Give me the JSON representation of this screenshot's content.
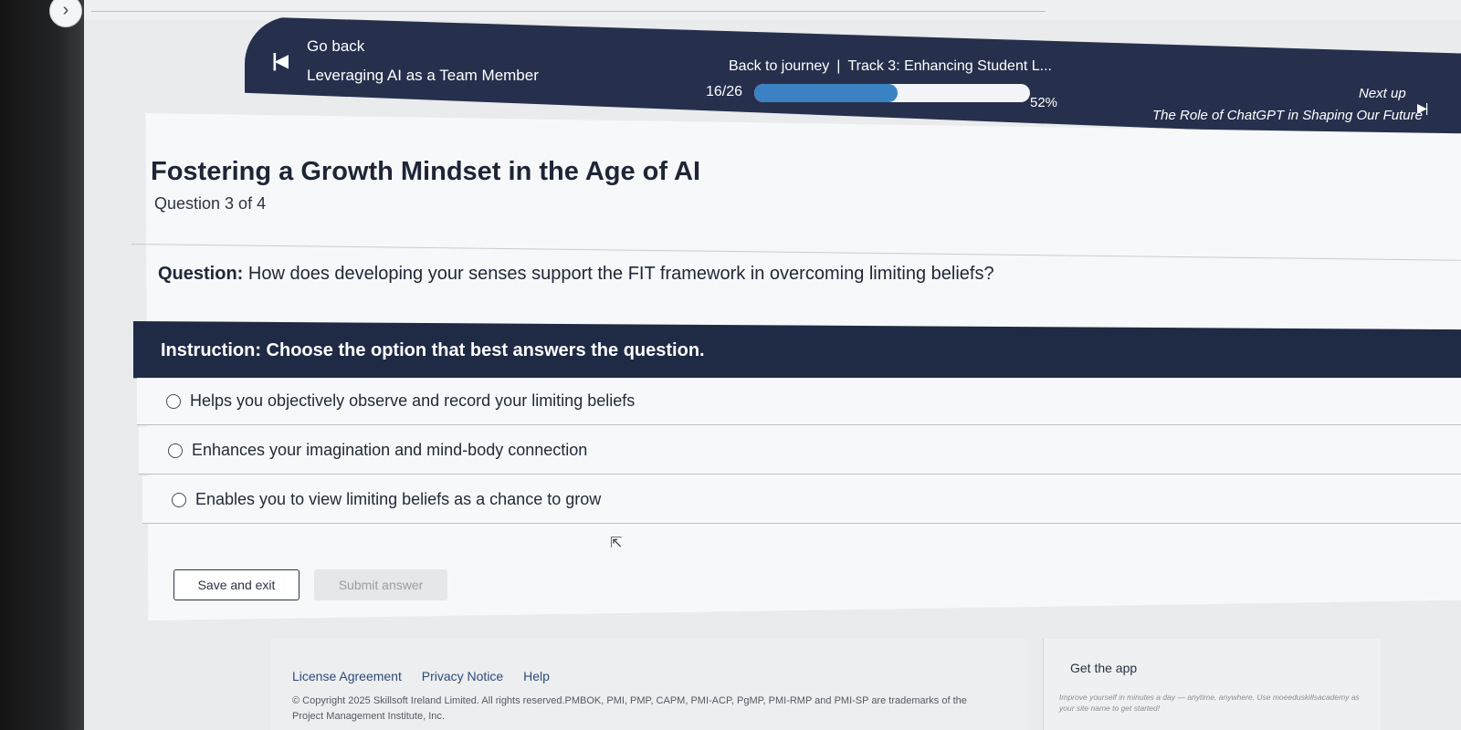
{
  "header": {
    "go_back_label": "Go back",
    "course_title": "Leveraging AI as a Team Member",
    "journey_link": "Back to journey",
    "track": "Track 3: Enhancing Student L...",
    "progress_text": "16/26",
    "progress_value": 0.52,
    "progress_percent": "52%",
    "next_up_label": "Next up",
    "next_up_title": "The Role of ChatGPT in Shaping Our Future"
  },
  "quiz": {
    "title": "Fostering a Growth Mindset in the Age of AI",
    "question_count": "Question 3 of 4",
    "question_prefix": "Question:",
    "question_text": "How does developing your senses support the FIT framework in overcoming limiting beliefs?",
    "instruction": "Instruction: Choose the option that best answers the question.",
    "options": [
      {
        "label": "Helps you objectively observe and record your limiting beliefs",
        "selected": false
      },
      {
        "label": "Enhances your imagination and mind-body connection",
        "selected": false
      },
      {
        "label": "Enables you to view limiting beliefs as a chance to grow",
        "selected": false
      }
    ],
    "save_label": "Save and exit",
    "submit_label": "Submit answer"
  },
  "footer": {
    "links": [
      "License Agreement",
      "Privacy Notice",
      "Help"
    ],
    "copyright": "© Copyright 2025 Skillsoft Ireland Limited. All rights reserved.PMBOK, PMI, PMP, CAPM, PMI-ACP, PgMP, PMI-RMP and PMI-SP are trademarks of the Project Management Institute, Inc.",
    "app_title": "Get the app",
    "app_blurb": "Improve yourself in minutes a day — anytime, anywhere. Use moeeduskillsacademy as your site name to get started!"
  },
  "colors": {
    "header_bg": "#26304d",
    "instruction_bg": "#1f2a45",
    "progress_fill": "#3b82c4",
    "link": "#2e4a7a"
  },
  "icons": {
    "go_back": "skip-back-icon",
    "next_up": "skip-forward-icon",
    "top_nav": "chevron-right-icon"
  }
}
